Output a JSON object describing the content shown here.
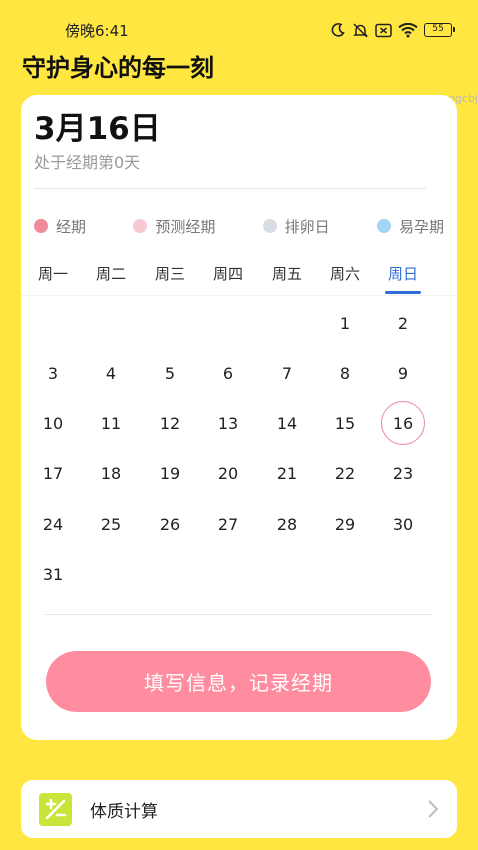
{
  "status_bar": {
    "time": "傍晚6:41",
    "battery": "55"
  },
  "headline": "守护身心的每一刻",
  "watermark": "ggcbj",
  "calendar_card": {
    "date_title": "3月16日",
    "subtitle": "处于经期第0天",
    "legend": [
      {
        "label": "经期",
        "color": "#EE8A99"
      },
      {
        "label": "预测经期",
        "color": "#F8C9D2"
      },
      {
        "label": "排卵日",
        "color": "#D8DCE3"
      },
      {
        "label": "易孕期",
        "color": "#A3D6F5"
      }
    ],
    "weekdays": [
      "周一",
      "周二",
      "周三",
      "周四",
      "周五",
      "周六",
      "周日"
    ],
    "active_weekday": "周日",
    "days": [
      "1",
      "2",
      "3",
      "4",
      "5",
      "6",
      "7",
      "8",
      "9",
      "10",
      "11",
      "12",
      "13",
      "14",
      "15",
      "16",
      "17",
      "18",
      "19",
      "20",
      "21",
      "22",
      "23",
      "24",
      "25",
      "26",
      "27",
      "28",
      "29",
      "30",
      "31"
    ],
    "first_weekday_index": 5,
    "today": "16",
    "record_button": "填写信息，记录经期"
  },
  "bottom_card": {
    "label": "体质计算"
  },
  "colors": {
    "background": "#FFE640",
    "accent_blue": "#2f6fd6",
    "button_pink": "#FF8C9F",
    "today_ring": "#e88aa0",
    "calc_icon_bg": "#C8E53A"
  }
}
